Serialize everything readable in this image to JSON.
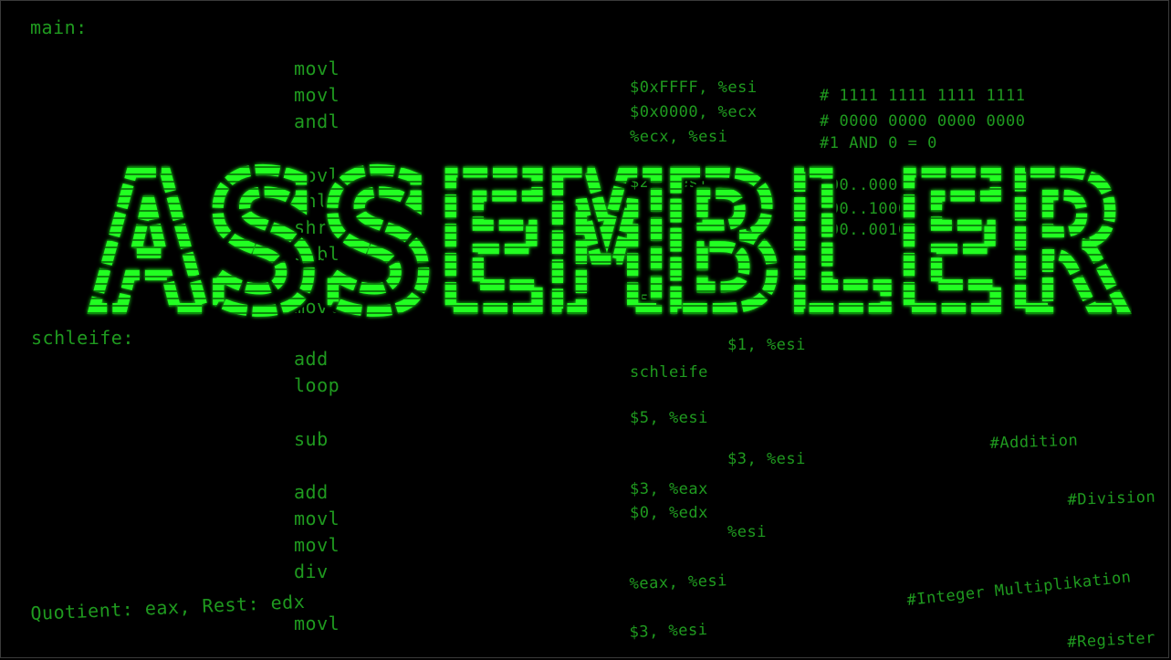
{
  "colors": {
    "background": "#000000",
    "code": "#1f9a1f",
    "title": "#22ff22"
  },
  "title": "ASSEMBLER",
  "labels": {
    "main": "main:",
    "schleife": "schleife:",
    "quotient": "Quotient: eax, Rest: edx"
  },
  "instructions": [
    "movl",
    "movl",
    "andl",
    "movl",
    "shll",
    "shrl",
    "subl",
    "movl",
    "add",
    "loop",
    "sub",
    "add",
    "movl",
    "movl",
    "div",
    "movl"
  ],
  "operands": [
    "$0xFFFF, %esi",
    "$0x0000, %ecx",
    "%ecx, %esi",
    "$2, %esi",
    "$5",
    "$1, %esi",
    "schleife",
    "$5, %esi",
    "$3, %esi",
    "$3, %eax",
    "$0, %edx",
    "%esi",
    "%eax, %esi",
    "$3, %esi"
  ],
  "comments": [
    "# 1111 1111 1111 1111",
    "# 0000 0000 0000 0000",
    "#1 AND 0 = 0",
    "#00..00010",
    "#00..1000",
    "#00..00100",
    "#Addition",
    "#Division",
    "#Integer Multiplikation",
    "#Register"
  ]
}
